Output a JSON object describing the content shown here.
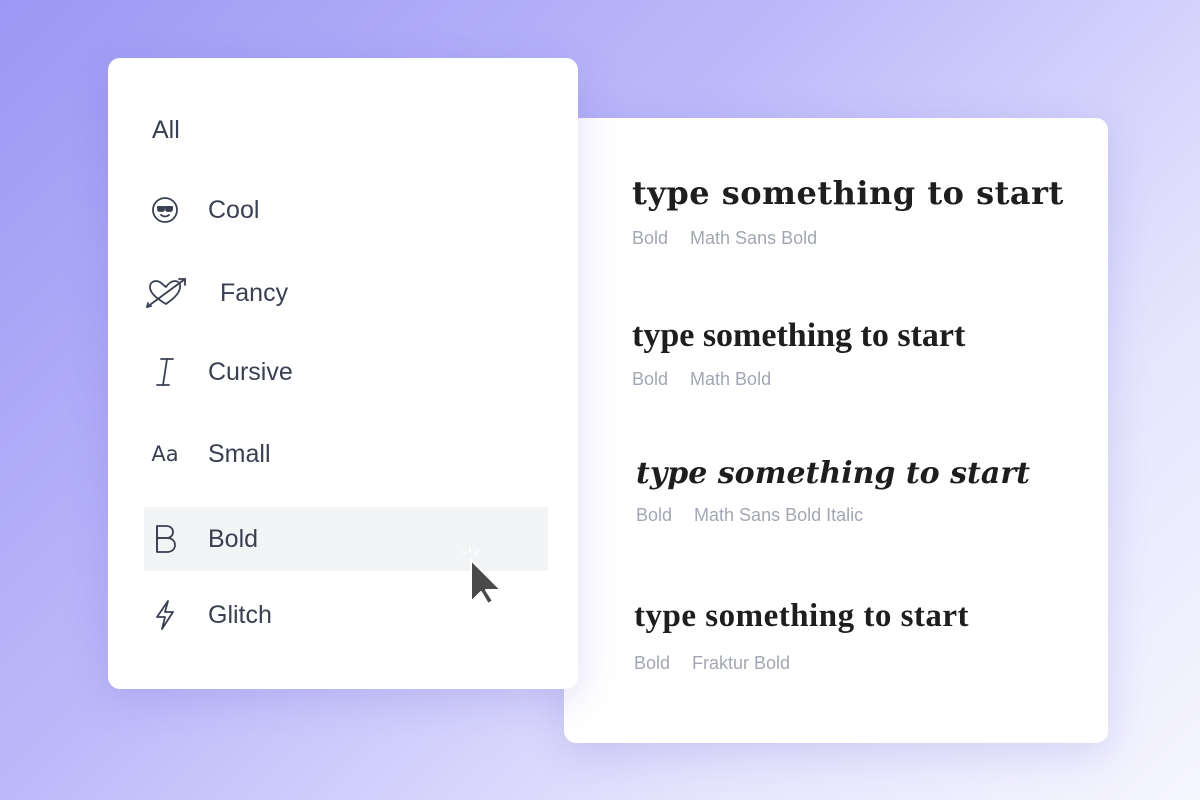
{
  "menu": {
    "items": [
      {
        "label": "All"
      },
      {
        "label": "Cool",
        "icon": "sunglasses-face-icon"
      },
      {
        "label": "Fancy",
        "icon": "heart-arrow-icon"
      },
      {
        "label": "Cursive",
        "icon": "italic-i-icon"
      },
      {
        "label": "Small",
        "icon": "text-size-aa-icon",
        "icon_text": "Aa"
      },
      {
        "label": "Bold",
        "icon": "bold-b-icon",
        "active": true
      },
      {
        "label": "Glitch",
        "icon": "lightning-icon"
      }
    ]
  },
  "previews": [
    {
      "text": "type something to start",
      "tags": [
        "Bold",
        "Math Sans Bold"
      ]
    },
    {
      "text": "type something to start",
      "tags": [
        "Bold",
        "Math Bold"
      ]
    },
    {
      "text": "type something to start",
      "tags": [
        "Bold",
        "Math Sans Bold Italic"
      ]
    },
    {
      "text": "type something to start",
      "tags": [
        "Bold",
        "Fraktur Bold"
      ]
    }
  ],
  "colors": {
    "background_start": "#9c98f4",
    "background_end": "#f6f6ff",
    "card": "#ffffff",
    "active_item": "#f3f4f6",
    "text": "#3a3f52",
    "tag_text": "#a3a7b3"
  }
}
